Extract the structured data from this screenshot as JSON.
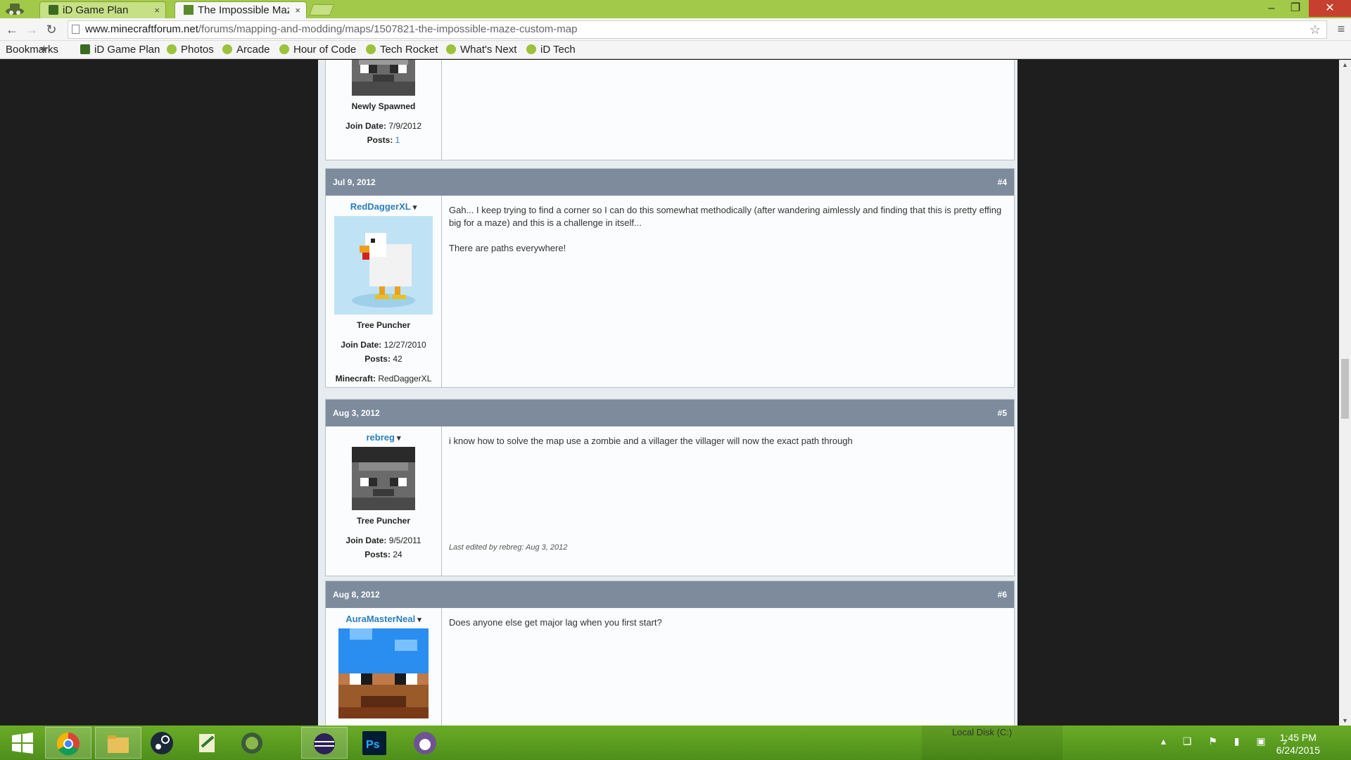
{
  "browser": {
    "tabs": [
      {
        "label": "iD Game Plan"
      },
      {
        "label": "The Impossible Maze"
      }
    ],
    "tab_close": "×",
    "url": {
      "domain": "www.minecraftforum.net",
      "path": "/forums/mapping-and-modding/maps/1507821-the-impossible-maze-custom-map"
    },
    "bookmarks": [
      {
        "label": "Bookmarks"
      },
      {
        "label": "iD Game Plan"
      },
      {
        "label": "Photos"
      },
      {
        "label": "Arcade"
      },
      {
        "label": "Hour of Code"
      },
      {
        "label": "Tech Rocket"
      },
      {
        "label": "What's Next"
      },
      {
        "label": "iD Tech"
      }
    ]
  },
  "posts": [
    {
      "rank": "Newly Spawned",
      "join_date_label": "Join Date:",
      "join_date": "7/9/2012",
      "posts_label": "Posts:",
      "posts": "1"
    },
    {
      "date": "Jul 9, 2012",
      "number": "#4",
      "username": "RedDaggerXL",
      "rank": "Tree Puncher",
      "join_date_label": "Join Date:",
      "join_date": "12/27/2010",
      "posts_label": "Posts:",
      "posts": "42",
      "minecraft_label": "Minecraft:",
      "minecraft": "RedDaggerXL",
      "message_1": "Gah... I keep trying to find a corner so I can do this somewhat methodically (after wandering aimlessly and finding that this is pretty effing big for a maze) and this is a challenge in itself...",
      "message_2": "There are paths everywhere!"
    },
    {
      "date": "Aug 3, 2012",
      "number": "#5",
      "username": "rebreg",
      "rank": "Tree Puncher",
      "join_date_label": "Join Date:",
      "join_date": "9/5/2011",
      "posts_label": "Posts:",
      "posts": "24",
      "message": "i know how to solve the map use a zombie and a villager the villager will now the exact path through",
      "edited": "Last edited by rebreg: Aug 3, 2012"
    },
    {
      "date": "Aug 8, 2012",
      "number": "#6",
      "username": "AuraMasterNeal",
      "message": "Does anyone else get major lag when you first start?"
    }
  ],
  "taskbar": {
    "tray_label": "Local Disk (C:)",
    "time": "1:45 PM",
    "date": "6/24/2015"
  }
}
